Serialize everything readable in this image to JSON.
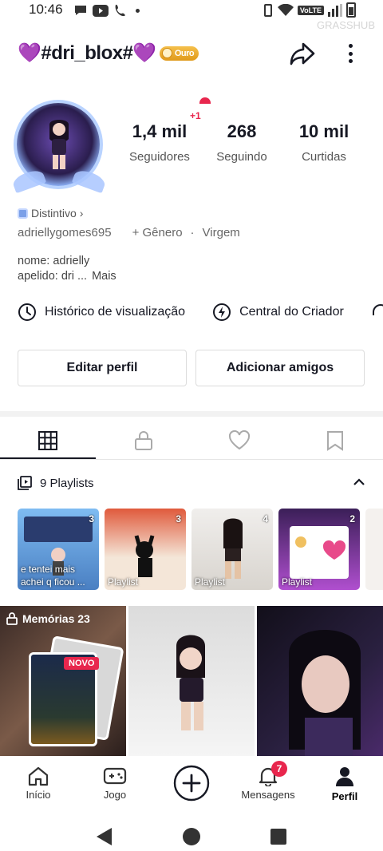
{
  "status_bar": {
    "time": "10:46",
    "network": "VoLTE"
  },
  "watermark": "GRASSHUB",
  "header": {
    "username": "💜#dri_blox#💜",
    "badge": "Ouro"
  },
  "stats": [
    {
      "value": "1,4 mil",
      "label": "Seguidores"
    },
    {
      "value": "268",
      "label": "Seguindo"
    },
    {
      "value": "10 mil",
      "label": "Curtidas"
    }
  ],
  "avatar_plus": "+1",
  "distintivo": "Distintivo",
  "meta": {
    "handle": "adriellygomes695",
    "gender_prefix": "+ Gênero",
    "sign": "Virgem"
  },
  "bio": {
    "line1": "nome: adrielly",
    "line2": "apelido: dri ...",
    "more": "Mais"
  },
  "shortcuts": [
    {
      "label": "Histórico de visualização"
    },
    {
      "label": "Central do Criador"
    }
  ],
  "buttons": {
    "edit": "Editar perfil",
    "add_friends": "Adicionar amigos"
  },
  "playlists": {
    "header": "9 Playlists",
    "items": [
      {
        "count": "3",
        "title": "e tentei mais achei q ficou ...",
        "color": "#6aa8e6"
      },
      {
        "count": "3",
        "title": "Playlist",
        "color": "#c44a3a"
      },
      {
        "count": "4",
        "title": "Playlist",
        "color": "#e9e6e2"
      },
      {
        "count": "2",
        "title": "Playlist",
        "color": "#9a3fb8"
      }
    ]
  },
  "grid": {
    "memories_label": "Memórias 23",
    "novo": "NOVO"
  },
  "bottom_nav": [
    {
      "label": "Início"
    },
    {
      "label": "Jogo"
    },
    {
      "label": ""
    },
    {
      "label": "Mensagens",
      "badge": "7"
    },
    {
      "label": "Perfil"
    }
  ]
}
